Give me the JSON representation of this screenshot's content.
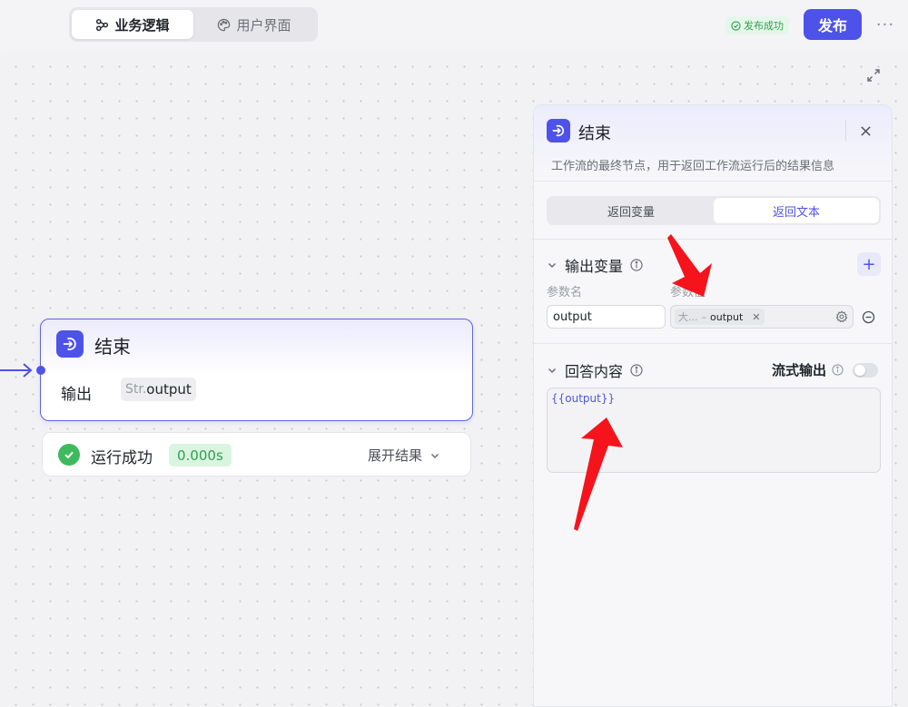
{
  "topbar": {
    "tabs": [
      {
        "label": "业务逻辑",
        "icon": "workflow-icon",
        "active": true
      },
      {
        "label": "用户界面",
        "icon": "palette-icon",
        "active": false
      }
    ],
    "publish_status": "发布成功",
    "publish_button": "发布",
    "more": "···"
  },
  "node": {
    "title": "结束",
    "output_label": "输出",
    "output_type": "Str.",
    "output_name": "output"
  },
  "run_result": {
    "status": "运行成功",
    "time": "0.000s",
    "expand_label": "展开结果"
  },
  "panel": {
    "title": "结束",
    "description": "工作流的最终节点，用于返回工作流运行后的结果信息",
    "tabs": [
      {
        "label": "返回变量",
        "active": false
      },
      {
        "label": "返回文本",
        "active": true
      }
    ],
    "output_section": {
      "title": "输出变量",
      "col_name": "参数名",
      "col_value": "参数值",
      "rows": [
        {
          "name": "output",
          "value_source": "大...",
          "value_var": "output"
        }
      ]
    },
    "answer_section": {
      "title": "回答内容",
      "stream_label": "流式输出",
      "stream_enabled": false,
      "content": "{{output}}"
    }
  },
  "colors": {
    "accent": "#4d53e8",
    "success": "#3fb95f",
    "annotation_arrow": "#f5141b"
  }
}
